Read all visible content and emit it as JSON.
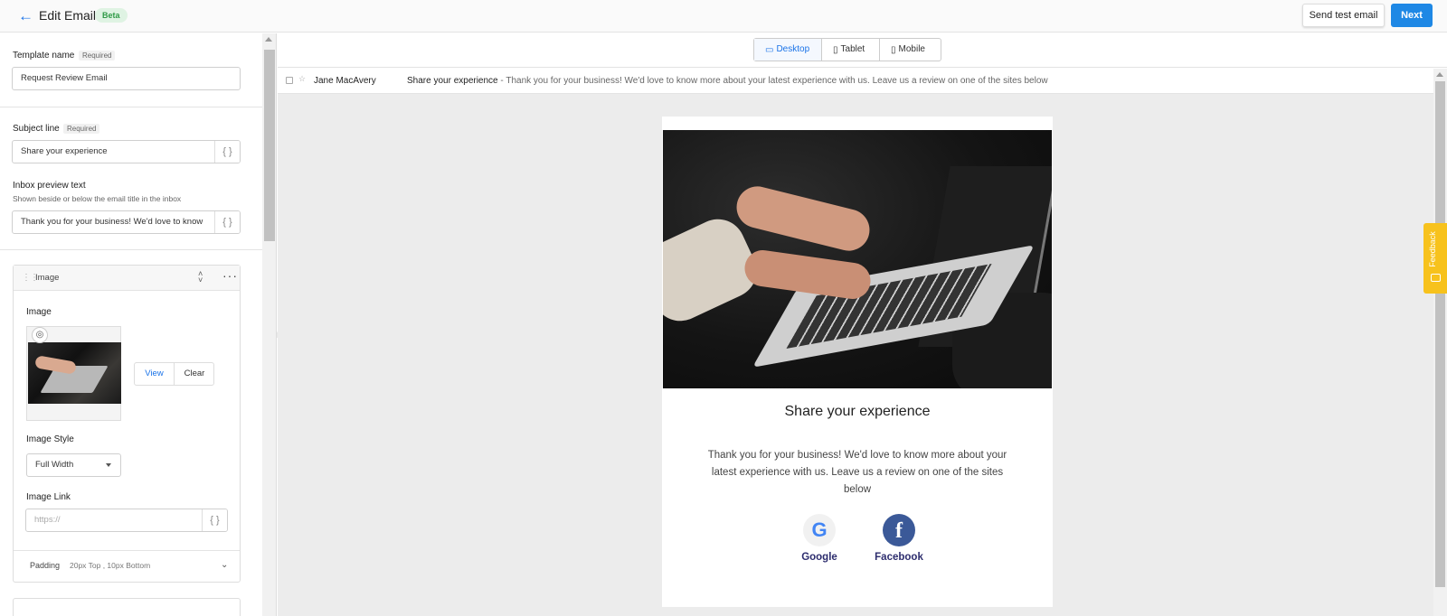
{
  "header": {
    "title": "Edit Email",
    "badge": "Beta",
    "send_test_label": "Send test email",
    "next_label": "Next"
  },
  "form": {
    "template_name": {
      "label": "Template name",
      "required": "Required",
      "value": "Request Review Email"
    },
    "subject_line": {
      "label": "Subject line",
      "required": "Required",
      "value": "Share your experience"
    },
    "inbox_preview": {
      "label": "Inbox preview text",
      "hint": "Shown beside or below the email title in the inbox",
      "value": "Thank you for your business! We'd love to know"
    },
    "image_block": {
      "header": "Image",
      "image_label": "Image",
      "view_label": "View",
      "clear_label": "Clear",
      "style_label": "Image Style",
      "style_value": "Full Width",
      "link_label": "Image Link",
      "link_placeholder": "https://",
      "padding_label": "Padding",
      "padding_value": "20px Top ,  10px Bottom"
    }
  },
  "preview": {
    "devices": [
      "Desktop",
      "Tablet",
      "Mobile"
    ],
    "active_device": "Desktop",
    "inbox": {
      "sender": "Jane MacAvery",
      "subject": "Share your experience",
      "preview_text": " - Thank you for your business! We'd love to know more about your latest experience with us. Leave us a review on one of the sites below"
    },
    "email": {
      "title": "Share your experience",
      "body": "Thank you for your business! We'd love to know more about your latest experience with us. Leave us a review on one of the sites below",
      "sites": [
        "Google",
        "Facebook"
      ]
    }
  },
  "feedback_tab": "Feedback",
  "colors": {
    "accent": "#1e88e5",
    "beta_bg": "#dff3e3",
    "feedback": "#f7c21d",
    "facebook": "#3b5998",
    "site_label": "#2d2d6e"
  },
  "icons": [
    "back-arrow-icon",
    "braces-icon",
    "drag-handle-icon",
    "sort-icon",
    "more-icon",
    "paperclip-icon",
    "chevron-down-icon",
    "desktop-icon",
    "tablet-icon",
    "mobile-icon",
    "star-icon",
    "google-icon",
    "facebook-icon"
  ]
}
